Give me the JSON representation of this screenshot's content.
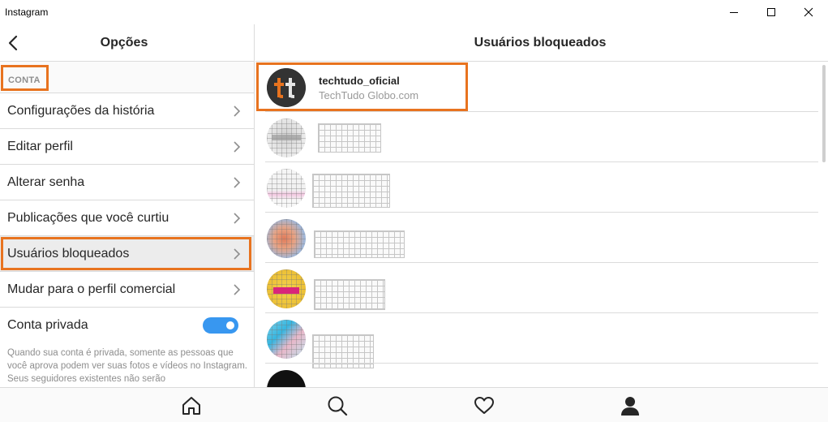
{
  "window": {
    "title": "Instagram",
    "controls": {
      "minimize_icon": "minimize-icon",
      "maximize_icon": "maximize-icon",
      "close_icon": "close-icon"
    }
  },
  "left_pane": {
    "title": "Opções",
    "back_icon": "back-arrow-icon",
    "section_label": "CONTA",
    "items": [
      {
        "label": "Configurações da história",
        "icon": "chevron-right-icon"
      },
      {
        "label": "Editar perfil",
        "icon": "chevron-right-icon"
      },
      {
        "label": "Alterar senha",
        "icon": "chevron-right-icon"
      },
      {
        "label": "Publicações que você curtiu",
        "icon": "chevron-right-icon"
      },
      {
        "label": "Usuários bloqueados",
        "icon": "chevron-right-icon",
        "selected": true
      },
      {
        "label": "Mudar para o perfil comercial",
        "icon": "chevron-right-icon"
      }
    ],
    "private_account": {
      "label": "Conta privada",
      "enabled": true
    },
    "private_note": "Quando sua conta é privada, somente as pessoas que você aprova podem ver suas fotos e vídeos no Instagram. Seus seguidores existentes não serão"
  },
  "right_pane": {
    "title": "Usuários bloqueados",
    "users": [
      {
        "username": "techtudo_oficial",
        "full_name": "TechTudo Globo.com",
        "avatar_text": "tt"
      }
    ]
  },
  "bottom_nav": {
    "items": [
      "home-icon",
      "search-icon",
      "heart-icon",
      "profile-icon"
    ]
  },
  "colors": {
    "highlight": "#e8731f",
    "toggle_on": "#3897f0",
    "avatar_bg": "#333333",
    "avatar_accent": "#e8731f"
  }
}
